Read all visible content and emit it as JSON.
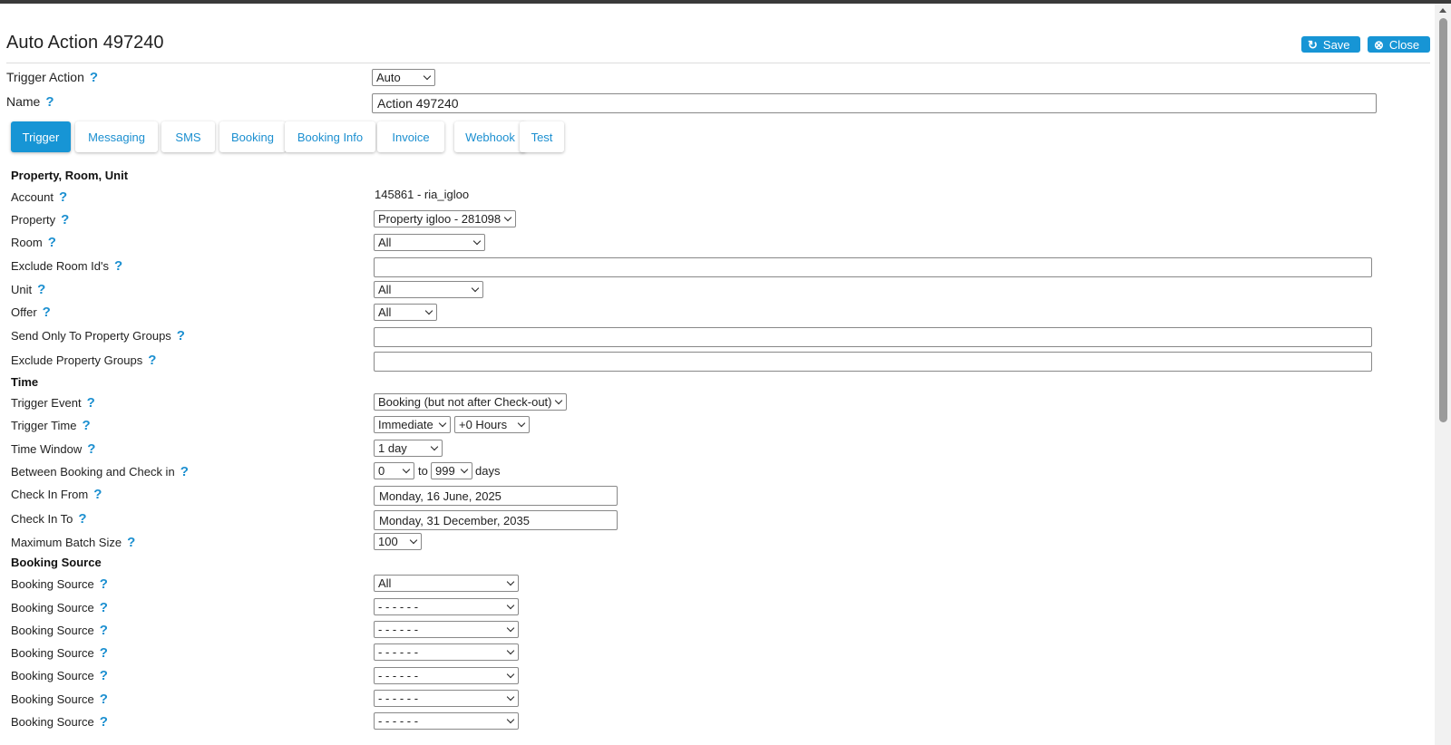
{
  "page": {
    "title": "Auto Action 497240",
    "save_label": "Save",
    "close_label": "Close"
  },
  "top_fields": {
    "trigger_action_label": "Trigger Action",
    "trigger_action_value": "Auto",
    "name_label": "Name",
    "name_value": "Action 497240"
  },
  "tabs": [
    {
      "label": "Trigger",
      "active": true
    },
    {
      "label": "Messaging"
    },
    {
      "label": "SMS"
    },
    {
      "label": "Booking"
    },
    {
      "label": "Booking Info"
    },
    {
      "label": "Invoice"
    },
    {
      "label": "Webhook"
    },
    {
      "label": "Test"
    }
  ],
  "sections": {
    "property": "Property, Room, Unit",
    "time": "Time",
    "booking_source": "Booking Source"
  },
  "fields": {
    "account_label": "Account",
    "account_value": "145861 - ria_igloo",
    "property_label": "Property",
    "property_value": "Property igloo - 281098",
    "room_label": "Room",
    "room_value": "All",
    "exclude_room_label": "Exclude Room Id's",
    "exclude_room_value": "",
    "unit_label": "Unit",
    "unit_value": "All",
    "offer_label": "Offer",
    "offer_value": "All",
    "send_only_groups_label": "Send Only To Property Groups",
    "send_only_groups_value": "",
    "exclude_groups_label": "Exclude Property Groups",
    "exclude_groups_value": "",
    "trigger_event_label": "Trigger Event",
    "trigger_event_value": "Booking (but not after Check-out)",
    "trigger_time_label": "Trigger Time",
    "trigger_time_value": "Immediate",
    "trigger_time_offset": "+0 Hours",
    "time_window_label": "Time Window",
    "time_window_value": "1 day",
    "between_label": "Between Booking and Check in",
    "between_from": "0",
    "between_to_word": "to",
    "between_to": "999",
    "between_unit": "days",
    "checkin_from_label": "Check In From",
    "checkin_from_value": "Monday, 16 June, 2025",
    "checkin_to_label": "Check In To",
    "checkin_to_value": "Monday, 31 December, 2035",
    "batch_label": "Maximum Batch Size",
    "batch_value": "100"
  },
  "booking_sources": [
    {
      "label": "Booking Source",
      "value": "All"
    },
    {
      "label": "Booking Source",
      "value": "- - - - - -"
    },
    {
      "label": "Booking Source",
      "value": "- - - - - -"
    },
    {
      "label": "Booking Source",
      "value": "- - - - - -"
    },
    {
      "label": "Booking Source",
      "value": "- - - - - -"
    },
    {
      "label": "Booking Source",
      "value": "- - - - - -"
    },
    {
      "label": "Booking Source",
      "value": "- - - - - -"
    }
  ],
  "help_glyph": "?",
  "colors": {
    "accent": "#1795d5",
    "help": "#1b8fd0"
  }
}
